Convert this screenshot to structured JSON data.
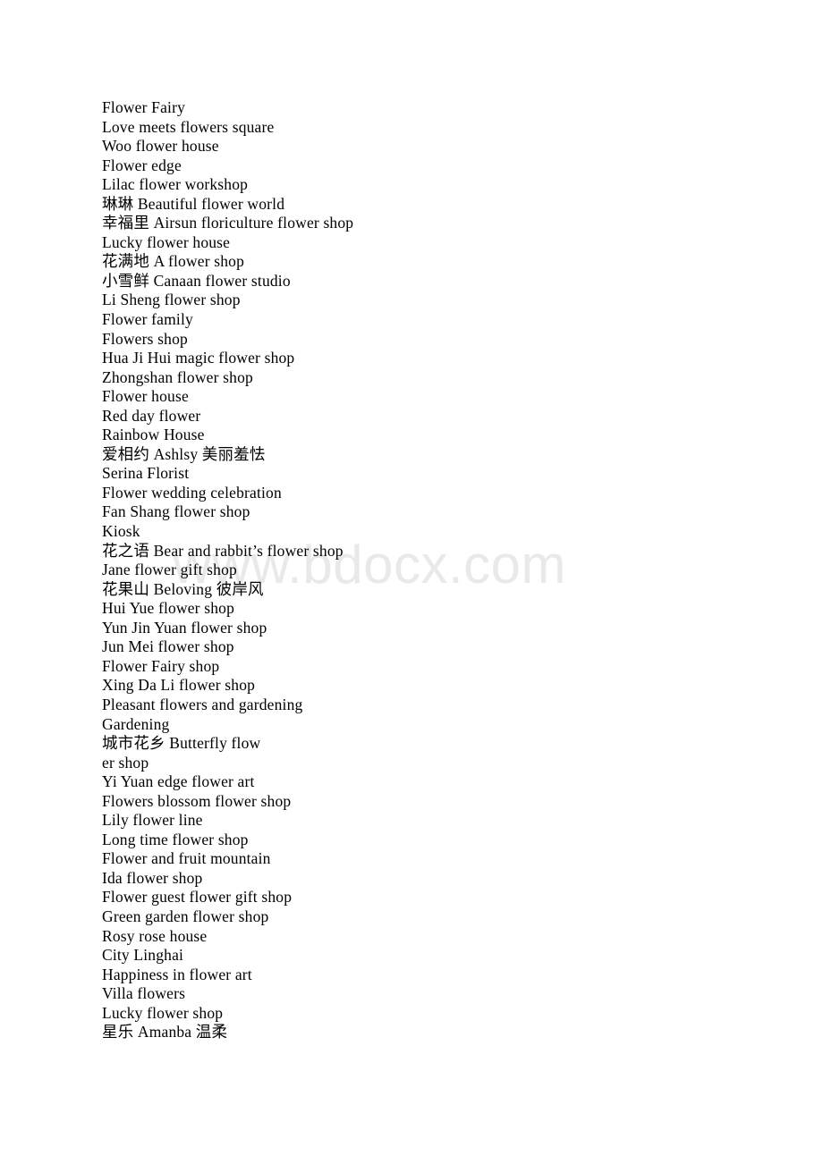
{
  "document": {
    "page_background": "#ffffff",
    "text_color": "#000000",
    "watermark": {
      "text": "www.bdocx.com",
      "color": "#e9e9e9"
    },
    "lines": [
      "Flower Fairy",
      "Love meets flowers square",
      "Woo flower house",
      "Flower edge",
      "Lilac flower workshop",
      "琳琳 Beautiful flower world",
      "幸福里 Airsun floriculture flower shop",
      "Lucky flower house",
      "花满地 A flower shop",
      "小雪鲜 Canaan flower studio",
      "Li Sheng flower shop",
      "Flower family",
      "Flowers shop",
      "Hua Ji Hui magic flower shop",
      "Zhongshan flower shop",
      "Flower house",
      "Red day flower",
      "Rainbow House",
      "爱相约 Ashlsy 美丽羞怯",
      "Serina Florist",
      "Flower wedding celebration",
      "Fan Shang flower shop",
      "Kiosk",
      "花之语 Bear and rabbit’s flower shop",
      "Jane flower gift shop",
      "花果山 Beloving 彼岸风",
      "Hui Yue flower shop",
      "Yun Jin Yuan flower shop",
      "Jun Mei flower shop",
      "Flower Fairy shop",
      "Xing Da Li flower shop",
      "Pleasant flowers and gardening",
      "Gardening",
      "城市花乡 Butterfly flow",
      "er shop",
      "Yi Yuan edge flower art",
      "Flowers blossom flower shop",
      "Lily flower line",
      "Long time flower shop",
      "Flower and fruit mountain",
      "Ida flower shop",
      "Flower guest flower gift shop",
      "Green garden flower shop",
      "Rosy rose house",
      "City Linghai",
      "Happiness in flower art",
      "Villa flowers",
      "Lucky flower shop",
      "星乐 Amanba 温柔"
    ]
  }
}
